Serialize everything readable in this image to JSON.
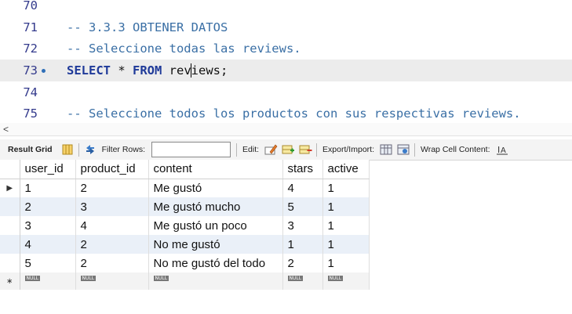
{
  "editor": {
    "lines": [
      {
        "number": "70",
        "text": ""
      },
      {
        "number": "71",
        "text": "-- 3.3.3 OBTENER DATOS"
      },
      {
        "number": "72",
        "text": "-- Seleccione todas las reviews."
      },
      {
        "number": "73",
        "kw1": "SELECT",
        "star": " * ",
        "kw2": "FROM",
        "before_caret": " rev",
        "after_caret": "iews;"
      },
      {
        "number": "74",
        "text": ""
      },
      {
        "number": "75",
        "text": "-- Seleccione todos los productos con sus respectivas reviews."
      }
    ]
  },
  "toolbar": {
    "result_grid": "Result Grid",
    "filter_rows": "Filter Rows:",
    "filter_value": "",
    "edit": "Edit:",
    "export_import": "Export/Import:",
    "wrap_cell": "Wrap Cell Content:"
  },
  "grid": {
    "columns": [
      "user_id",
      "product_id",
      "content",
      "stars",
      "active"
    ],
    "rows": [
      [
        "1",
        "2",
        "Me gustó",
        "4",
        "1"
      ],
      [
        "2",
        "3",
        "Me gustó mucho",
        "5",
        "1"
      ],
      [
        "3",
        "4",
        "Me gustó un poco",
        "3",
        "1"
      ],
      [
        "4",
        "2",
        "No me gustó",
        "1",
        "1"
      ],
      [
        "5",
        "2",
        "No me gustó del todo",
        "2",
        "1"
      ]
    ],
    "null_label": "NULL"
  },
  "icons": [
    "row-selected-arrow-icon",
    "grid-layout-icon",
    "refresh-icon",
    "edit-cell-icon",
    "add-row-icon",
    "delete-row-icon",
    "export-icon",
    "import-icon",
    "wrap-cell-icon"
  ],
  "colors": {
    "comment": "#3a6fa5",
    "keyword": "#1f3a99",
    "line_number": "#333a8c",
    "current_line": "#ececec",
    "alt_row": "#eaf0f8"
  }
}
